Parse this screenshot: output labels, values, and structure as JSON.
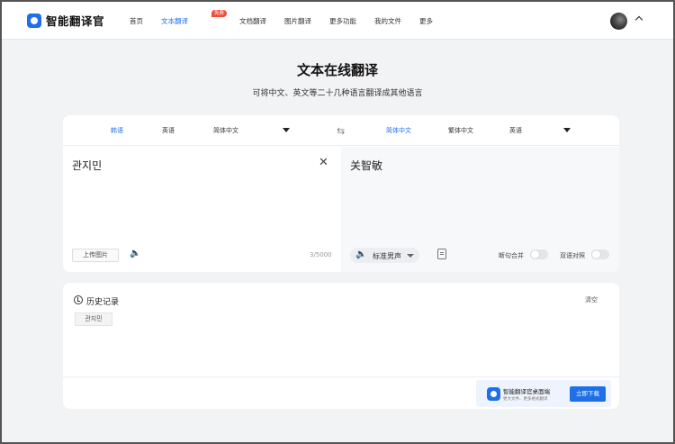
{
  "app": {
    "name": "智能翻译官"
  },
  "nav": {
    "items": [
      "首页",
      "文本翻译",
      "文档翻译",
      "图片翻译",
      "更多功能",
      "我的文件",
      "更多"
    ],
    "active_badge": "免费"
  },
  "hero": {
    "title": "文本在线翻译",
    "subtitle": "可将中文、英文等二十几种语言翻译成其他语言"
  },
  "source_langs": [
    "韩语",
    "英语",
    "简体中文"
  ],
  "target_langs": [
    "简体中文",
    "繁体中文",
    "英语"
  ],
  "source": {
    "text": "관지민",
    "upload_label": "上传图片",
    "char_count": "3/5000"
  },
  "target": {
    "text": "关智敏",
    "voice_label": "标准男声",
    "sentence_merge_label": "断句合并",
    "bilingual_label": "双语对照"
  },
  "history": {
    "title": "历史记录",
    "clear_label": "清空",
    "items": [
      "관지민"
    ]
  },
  "promo": {
    "title": "智能翻译官桌面端",
    "subtitle": "更大文件、更多格式翻译",
    "button_label": "立即下载"
  },
  "colors": {
    "accent": "#1f6fe8",
    "badge": "#f24d3a"
  }
}
